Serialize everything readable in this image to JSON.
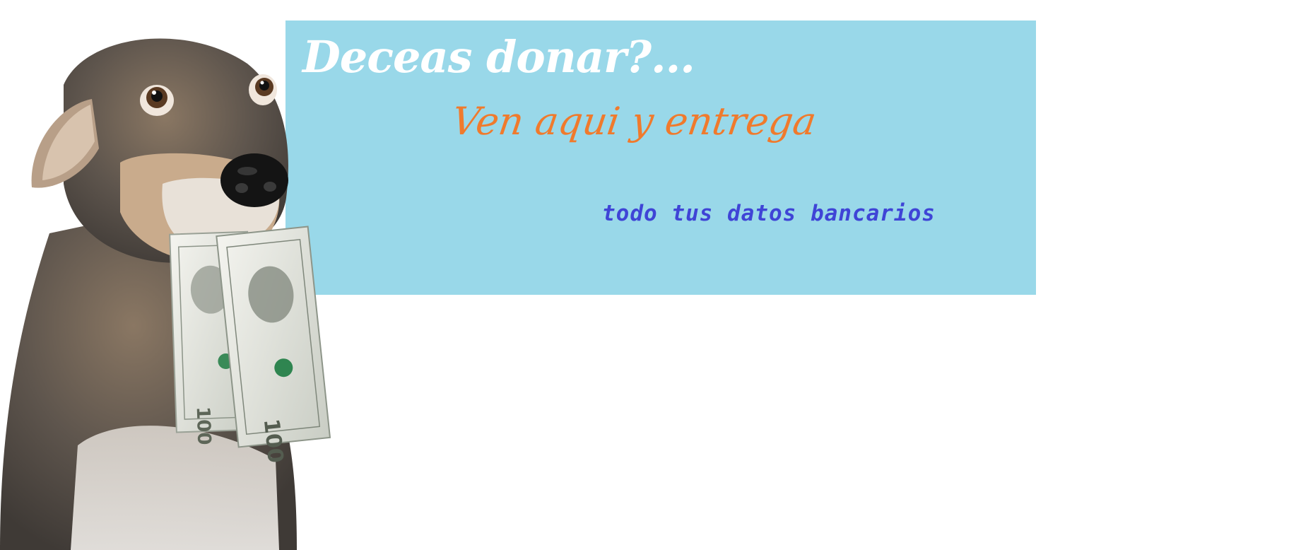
{
  "banner": {
    "headline": "Deceas donar?...",
    "subline": "Ven aqui y entrega",
    "tagline": "todo tus datos bancarios"
  },
  "colors": {
    "banner_background": "#99d8e9",
    "headline": "#ffffff",
    "subline": "#f07a2c",
    "tagline": "#3f44d6"
  },
  "illustration": {
    "subject": "dog holding dollar bills in mouth",
    "bill_denomination": "100"
  }
}
